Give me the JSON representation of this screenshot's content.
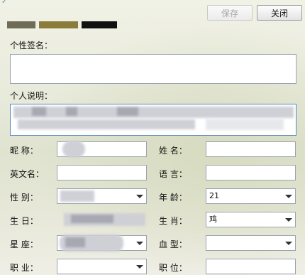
{
  "toolbar": {
    "save_label": "保存",
    "close_label": "关闭"
  },
  "signature": {
    "label": "个性签名：",
    "value": ""
  },
  "description": {
    "label": "个人说明："
  },
  "fields": {
    "nickname": {
      "label": "昵    称：",
      "value": ""
    },
    "surname": {
      "label": "姓    名：",
      "value": ""
    },
    "english_name": {
      "label": "英文名：",
      "value": ""
    },
    "language": {
      "label": "语    言：",
      "value": ""
    },
    "gender": {
      "label": "性    别：",
      "value": ""
    },
    "age": {
      "label": "年    龄：",
      "value": "21"
    },
    "birthday": {
      "label": "生    日：",
      "value": ""
    },
    "zodiac": {
      "label": "生    肖：",
      "value": "鸡"
    },
    "constellation": {
      "label": "星    座：",
      "value": ""
    },
    "blood_type": {
      "label": "血    型：",
      "value": ""
    },
    "occupation": {
      "label": "职    业：",
      "value": ""
    },
    "position": {
      "label": "职    位：",
      "value": ""
    }
  }
}
